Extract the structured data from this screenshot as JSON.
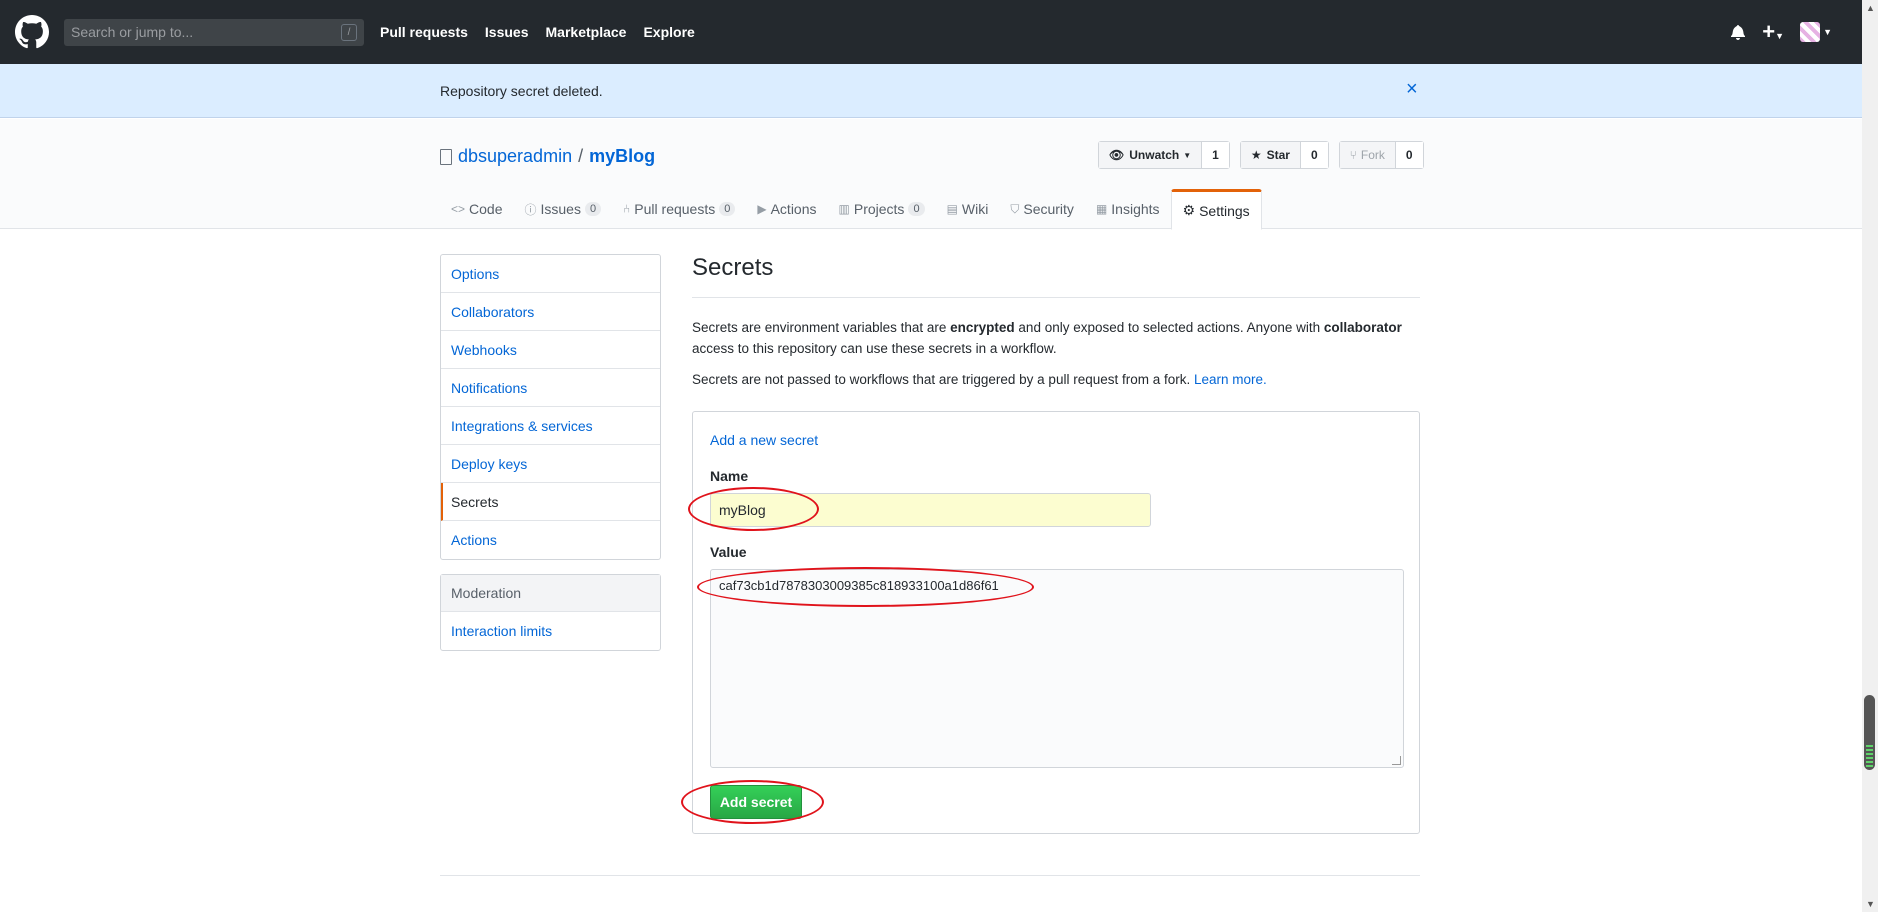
{
  "header": {
    "search_placeholder": "Search or jump to...",
    "search_shortcut": "/",
    "nav": [
      "Pull requests",
      "Issues",
      "Marketplace",
      "Explore"
    ]
  },
  "flash": {
    "message": "Repository secret deleted.",
    "close_icon": "×"
  },
  "repo": {
    "owner": "dbsuperadmin",
    "separator": "/",
    "name": "myBlog",
    "watch_label": "Unwatch",
    "watch_count": "1",
    "star_label": "Star",
    "star_count": "0",
    "fork_label": "Fork",
    "fork_count": "0"
  },
  "tabs": [
    {
      "label": "Code",
      "icon": "code-icon",
      "count": ""
    },
    {
      "label": "Issues",
      "icon": "issue-icon",
      "count": "0"
    },
    {
      "label": "Pull requests",
      "icon": "pr-icon",
      "count": "0"
    },
    {
      "label": "Actions",
      "icon": "play-icon",
      "count": ""
    },
    {
      "label": "Projects",
      "icon": "project-icon",
      "count": "0"
    },
    {
      "label": "Wiki",
      "icon": "book-icon",
      "count": ""
    },
    {
      "label": "Security",
      "icon": "shield-icon",
      "count": ""
    },
    {
      "label": "Insights",
      "icon": "graph-icon",
      "count": ""
    },
    {
      "label": "Settings",
      "icon": "gear-icon",
      "count": ""
    }
  ],
  "sidebar": {
    "items": [
      "Options",
      "Collaborators",
      "Webhooks",
      "Notifications",
      "Integrations & services",
      "Deploy keys",
      "Secrets",
      "Actions"
    ],
    "moderation_heading": "Moderation",
    "moderation_items": [
      "Interaction limits"
    ]
  },
  "main": {
    "title": "Secrets",
    "para1_a": "Secrets are environment variables that are ",
    "para1_b": "encrypted",
    "para1_c": " and only exposed to selected actions. Anyone with ",
    "para1_d": "collaborator",
    "para1_e": " access to this repository can use these secrets in a workflow.",
    "para2": "Secrets are not passed to workflows that are triggered by a pull request from a fork. ",
    "learn_more": "Learn more.",
    "add_new": "Add a new secret",
    "name_label": "Name",
    "name_value": "myBlog",
    "value_label": "Value",
    "value_text": "caf73cb1d7878303009385c818933100a1d86f61",
    "add_button": "Add secret"
  },
  "colors": {
    "header_bg": "#24292e",
    "flash_bg": "#dbedff",
    "link": "#0366d6",
    "tab_accent": "#e36209",
    "button_green": "#28a745",
    "annotation_red": "#e0131b"
  }
}
